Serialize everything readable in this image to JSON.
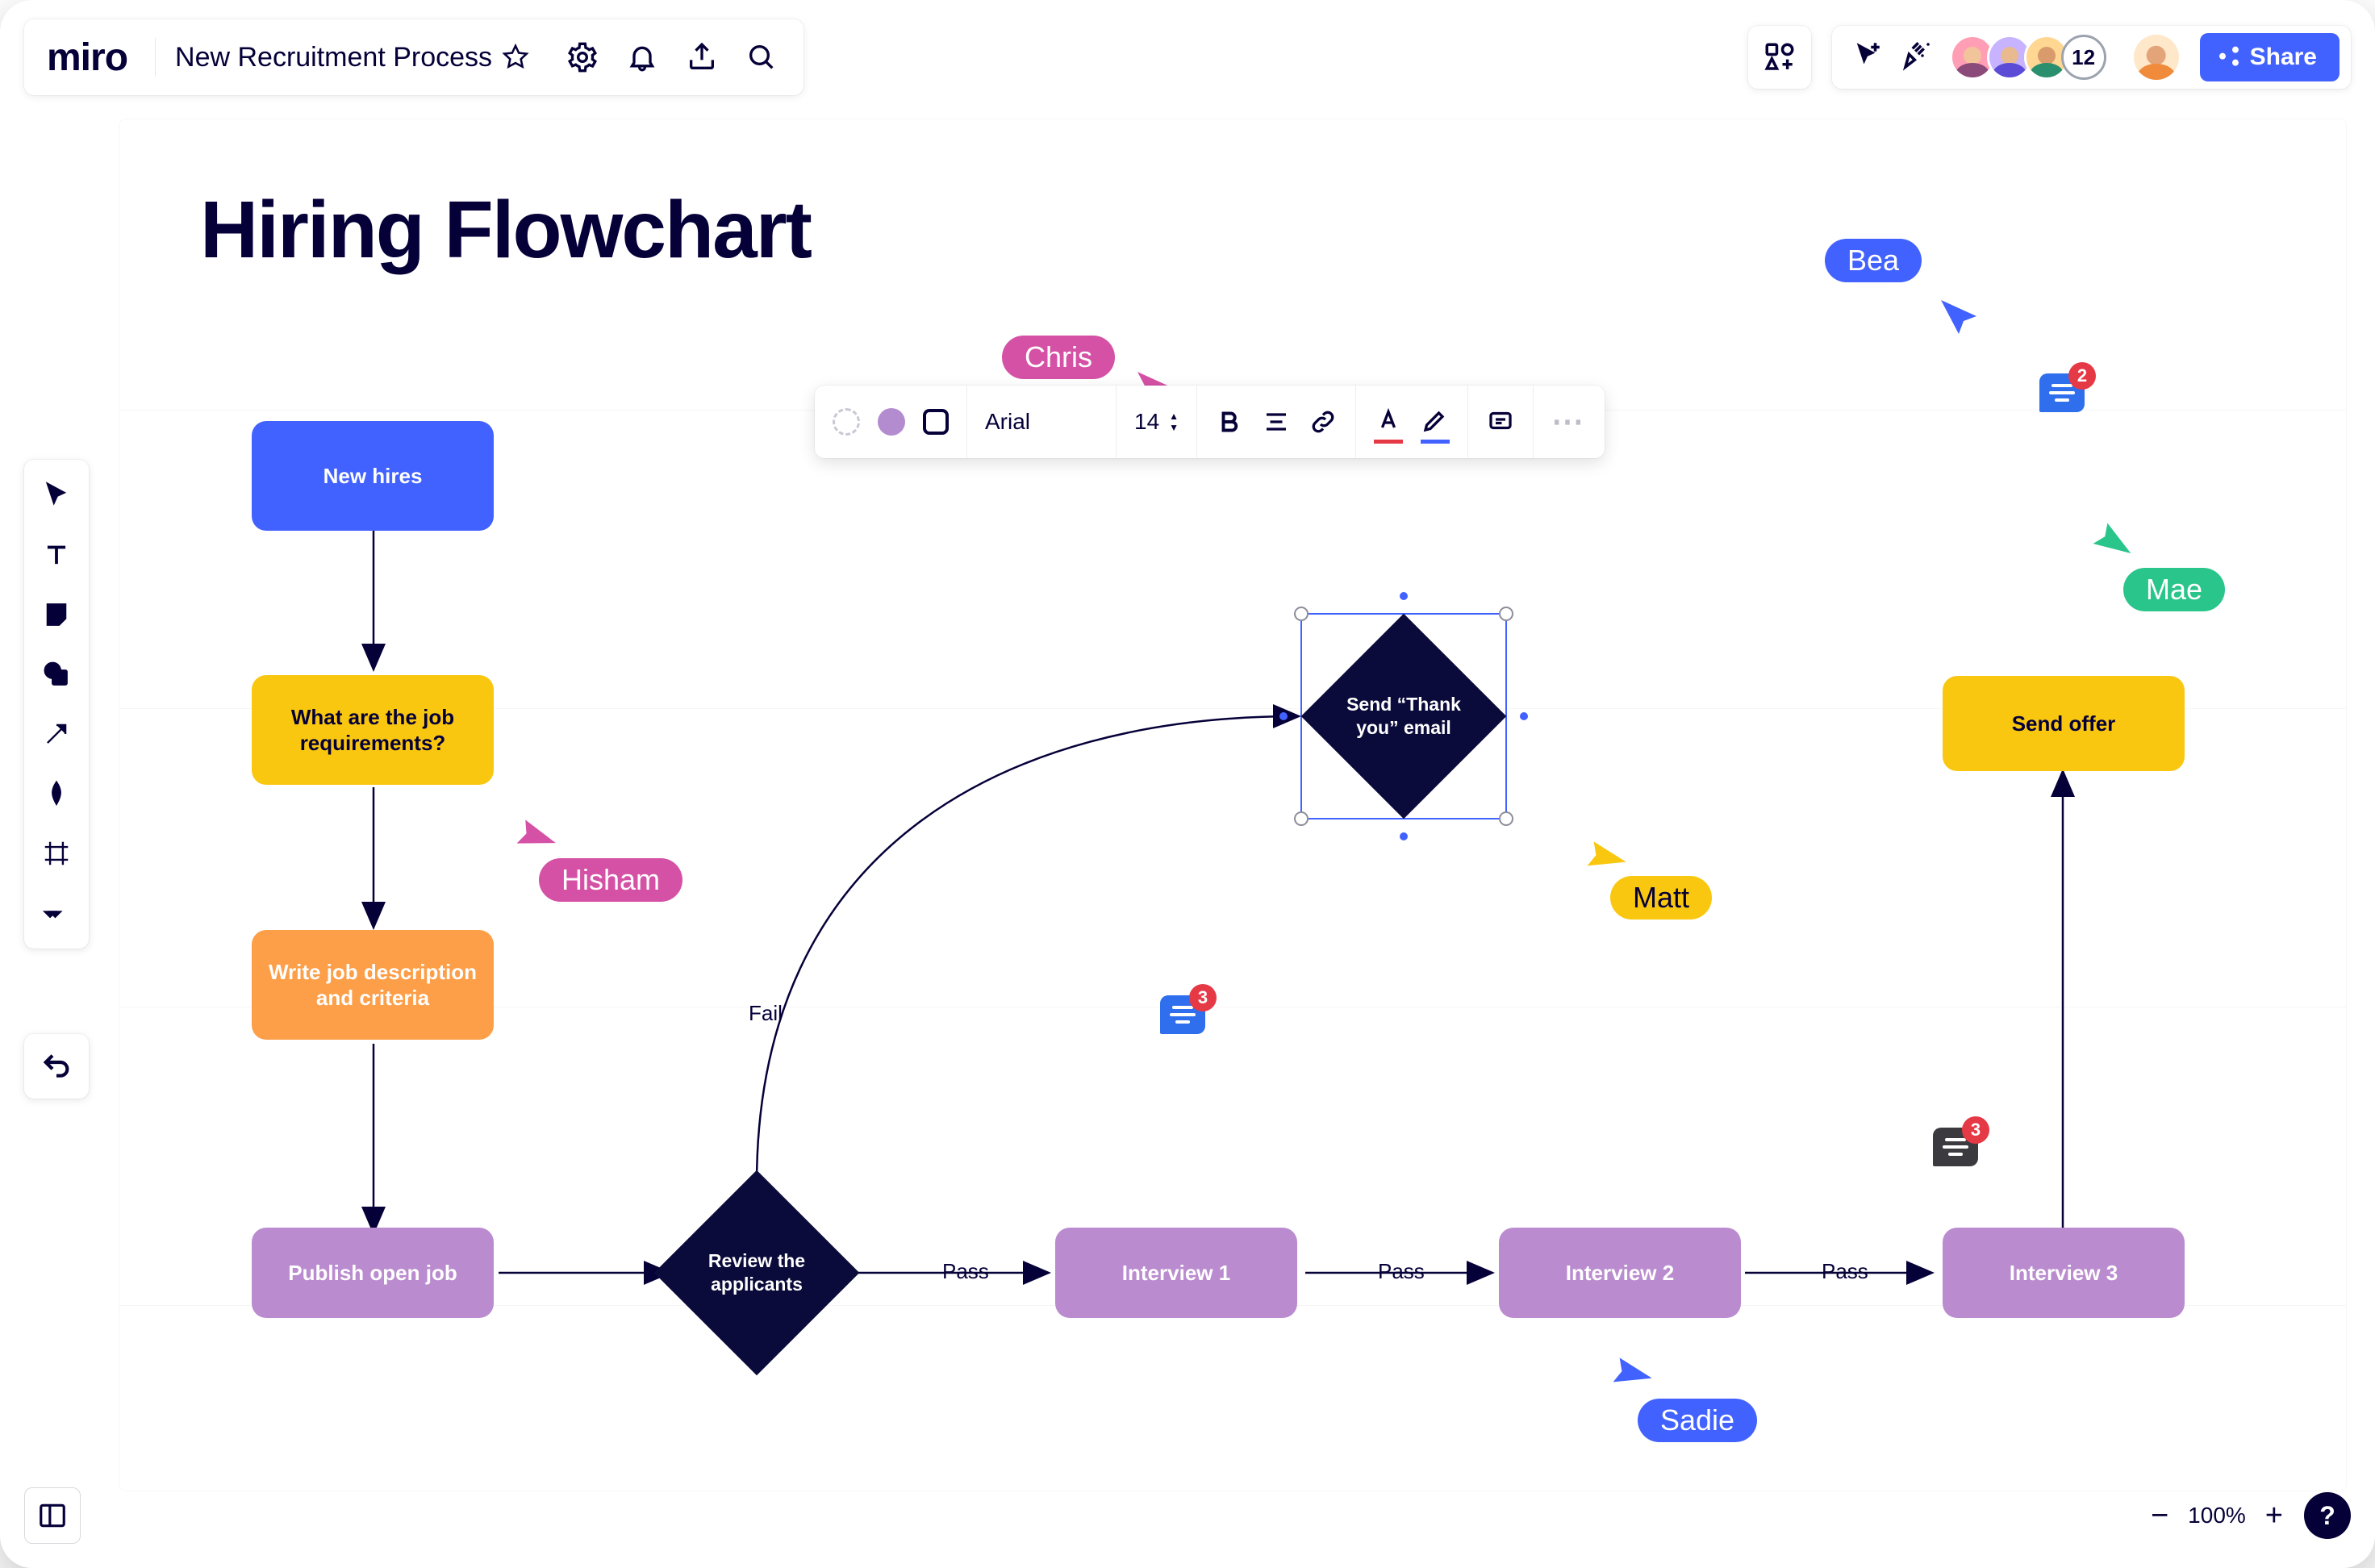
{
  "app": {
    "logo": "miro"
  },
  "header": {
    "board_name": "New Recruitment Process",
    "share_label": "Share",
    "avatar_overflow": "12"
  },
  "zoom": {
    "level": "100%"
  },
  "canvas": {
    "title": "Hiring Flowchart",
    "nodes": {
      "new_hires": "New hires",
      "requirements": "What are the job requirements?",
      "write_desc": "Write job description and criteria",
      "publish": "Publish open job",
      "review": "Review the applicants",
      "thank_you": "Send “Thank you” email",
      "interview1": "Interview 1",
      "interview2": "Interview 2",
      "interview3": "Interview 3",
      "send_offer": "Send offer"
    },
    "edge_labels": {
      "fail": "Fail",
      "pass": "Pass"
    },
    "cursors": {
      "chris": "Chris",
      "bea": "Bea",
      "hisham": "Hisham",
      "matt": "Matt",
      "mae": "Mae",
      "sadie": "Sadie"
    },
    "comments": {
      "c1": "3",
      "c2": "2",
      "c3": "3"
    }
  },
  "edit_toolbar": {
    "font": "Arial",
    "font_size": "14"
  },
  "colors": {
    "chris": "#d451a6",
    "bea": "#4262ff",
    "hisham": "#d451a6",
    "matt": "#fac710",
    "mae": "#2ac58b",
    "sadie": "#4262ff"
  }
}
